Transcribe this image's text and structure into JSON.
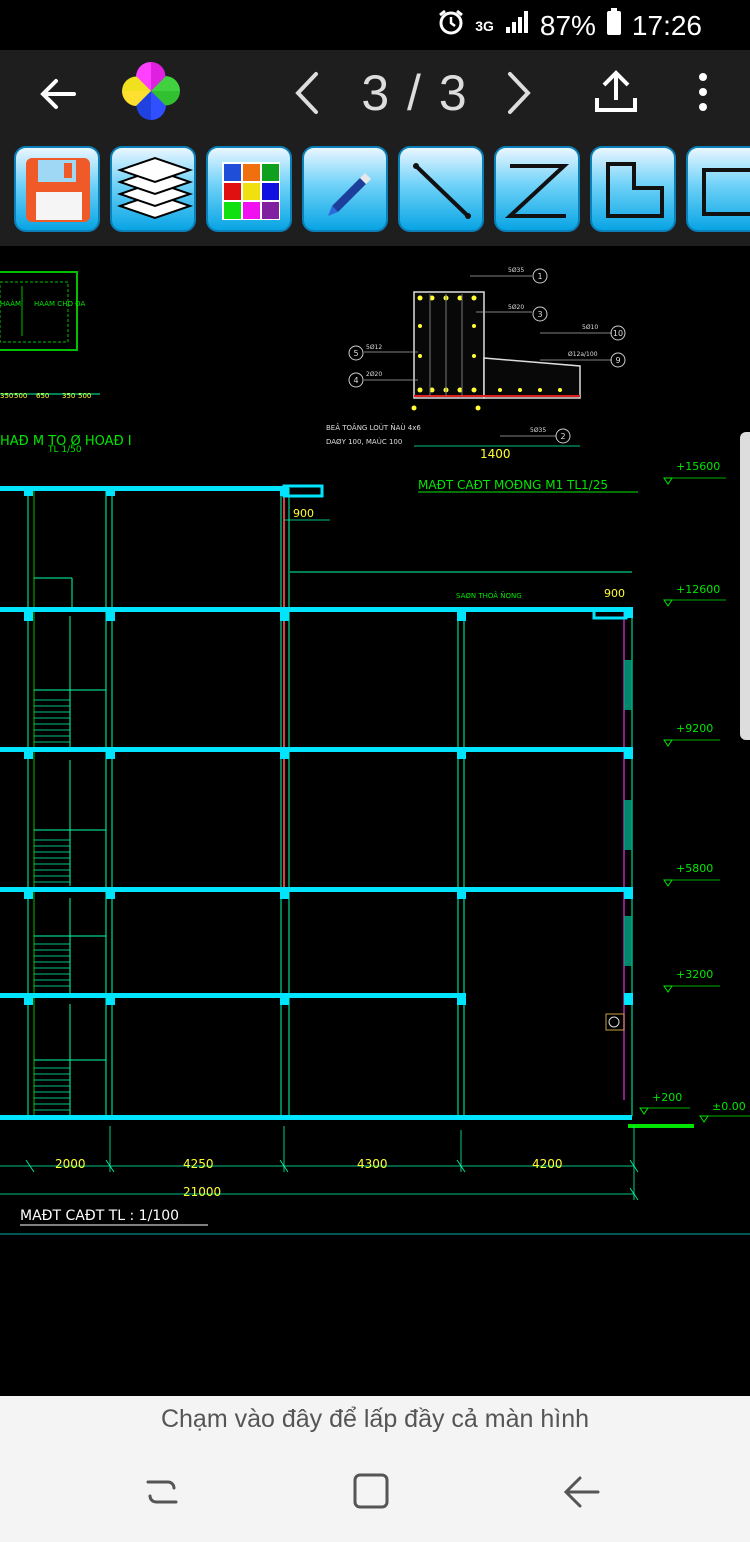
{
  "status_bar": {
    "alarm_icon": "alarm-clock-icon",
    "network": "3G",
    "battery_percent": "87%",
    "time": "17:26"
  },
  "app_bar": {
    "back_icon": "arrow-left-icon",
    "logo_icon": "pinwheel-logo-icon",
    "page_counter": "3 / 3",
    "prev_icon": "chevron-left-icon",
    "next_icon": "chevron-right-icon",
    "share_icon": "upload-icon",
    "menu_icon": "more-vert-icon"
  },
  "toolbar": {
    "tools": [
      "save-icon",
      "layers-icon",
      "color-palette-icon",
      "pen-icon",
      "line-icon",
      "polyline-icon",
      "polygon-icon",
      "rectangle-icon"
    ]
  },
  "drawing": {
    "elevations": [
      "+15600",
      "+12600",
      "+9200",
      "+5800",
      "+3200",
      "+200",
      "±0.00"
    ],
    "dim_900_upper": "900",
    "dim_900_lower": "900",
    "dims_bottom": [
      "2000",
      "4250",
      "4300",
      "4200"
    ],
    "dim_total": "21000",
    "section_title": "MAĐT CAĐT TL : 1/100",
    "detail_title": "MAĐT CAĐT MOĐNG M1 TL1/25",
    "detail_dim": "1400",
    "detail_note_1": "BEÂ TOÂNG LOÙT ÑAÙ 4x6",
    "detail_note_2": "DAØY 100, MAÙC 100",
    "detail_callouts": [
      "1",
      "3",
      "10",
      "9",
      "5",
      "4",
      "2"
    ],
    "detail_rebar": [
      "5Ø35",
      "5Ø20",
      "5Ø10",
      "Ø12a/100",
      "5Ø12",
      "2Ø20",
      "5Ø35"
    ],
    "left_title": "HAĐ M TO Ø HOAĐ I",
    "left_scale": "TL 1/50",
    "left_room_1": "HAÀM",
    "left_room_2": "HAÀM CHO ĐA",
    "floor_label": "SAØN THOÂ ÑONG",
    "left_dims": [
      "350",
      "500",
      "650",
      "350",
      "500"
    ]
  },
  "hint": {
    "text": "Chạm vào đây để lấp đầy cả màn hình"
  },
  "nav_bar": {
    "recents_icon": "recents-icon",
    "home_icon": "home-square-icon",
    "back_icon": "nav-back-icon"
  },
  "colors": {
    "cyan": "#00e5ff",
    "green": "#00e600",
    "yellow": "#ffff33",
    "bg": "#000000"
  }
}
